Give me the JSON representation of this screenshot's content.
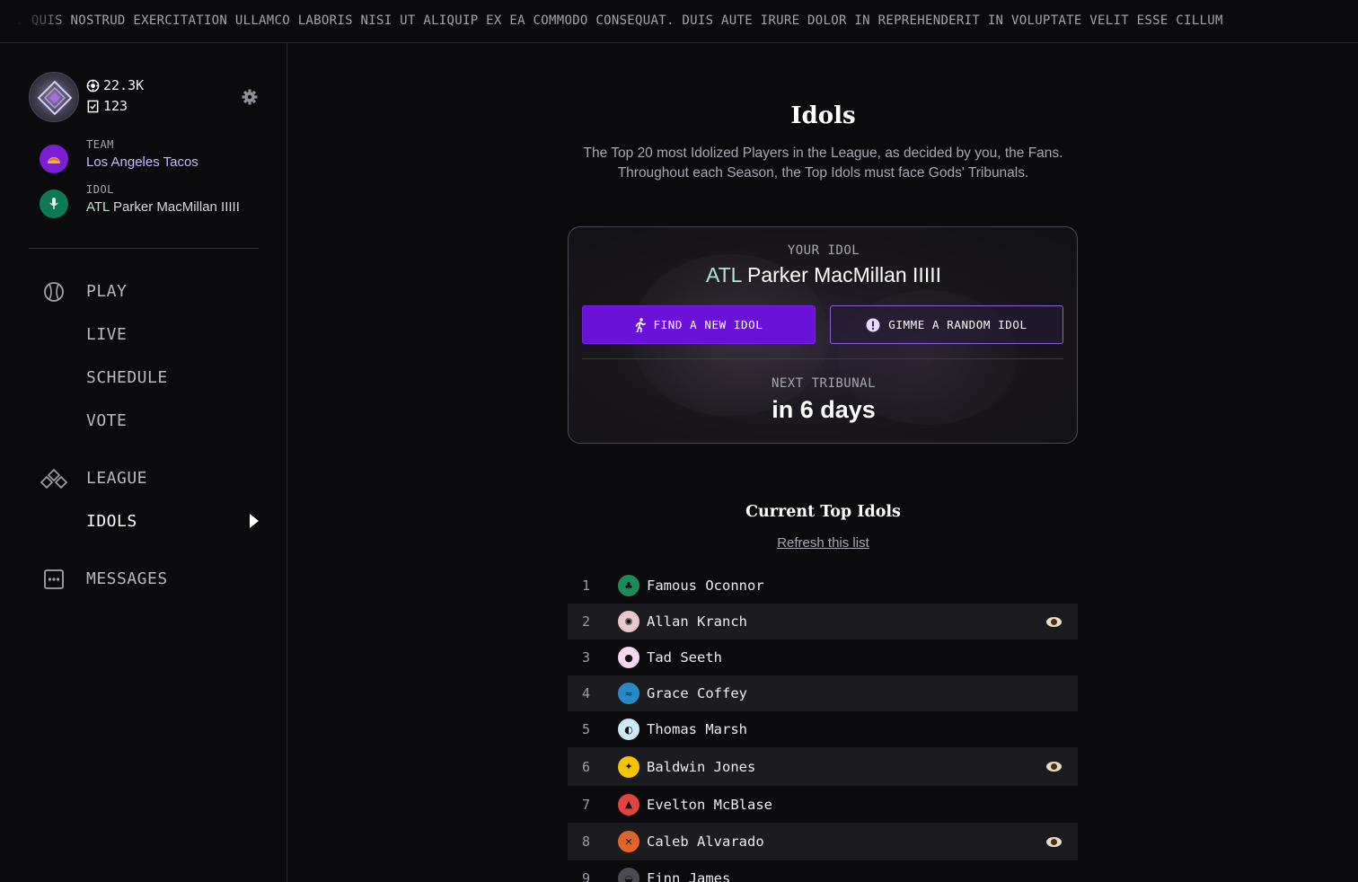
{
  "ticker": {
    "text": "AM. QUIS NOSTRUD EXERCITATION ULLAMCO LABORIS NISI UT ALIQUIP EX EA COMMODO CONSEQUAT. DUIS AUTE IRURE DOLOR IN REPREHENDERIT IN VOLUPTATE VELIT ESSE CILLUM"
  },
  "profile": {
    "coins": "22.3K",
    "votes": "123",
    "coins_icon": "coin-icon",
    "votes_icon": "vote-icon",
    "settings_icon": "gear-icon"
  },
  "favorites": {
    "team": {
      "label": "TEAM",
      "value": "Los Angeles Tacos",
      "icon": "taco-icon",
      "color": "#7b1fd6"
    },
    "idol": {
      "label": "IDOL",
      "abbr": "ATL",
      "value": "Parker MacMillan IIIII",
      "icon": "microphone-icon",
      "color": "#0c7a55"
    }
  },
  "nav": [
    {
      "label": "PLAY",
      "icon": "baseball-icon",
      "active": false
    },
    {
      "label": "LIVE",
      "active": false
    },
    {
      "label": "SCHEDULE",
      "active": false
    },
    {
      "label": "VOTE",
      "active": false
    },
    {
      "label": "LEAGUE",
      "icon": "diamonds-icon",
      "active": false
    },
    {
      "label": "IDOLS",
      "active": true
    },
    {
      "label": "MESSAGES",
      "icon": "chat-icon",
      "active": false
    }
  ],
  "main": {
    "title": "Idols",
    "subtitle_line1": "The Top 20 most Idolized Players in the League, as decided by you, the Fans.",
    "subtitle_line2": "Throughout each Season, the Top Idols must face Gods' Tribunals."
  },
  "idol_card": {
    "label": "YOUR IDOL",
    "team_abbr": "ATL",
    "player": "Parker MacMillan IIIII",
    "find_button": "FIND A NEW IDOL",
    "random_button": "GIMME A RANDOM IDOL",
    "next_label": "NEXT TRIBUNAL",
    "next_value": "in 6 days"
  },
  "top_idols": {
    "title": "Current Top Idols",
    "refresh_label": "Refresh this list",
    "rows": [
      {
        "rank": "1",
        "name": "Famous Oconnor",
        "icon": "frog-icon",
        "color": "#1a8a5a",
        "glyph": "♣",
        "watched": false
      },
      {
        "rank": "2",
        "name": "Allan Kranch",
        "icon": "crab-icon",
        "color": "#e8c9d0",
        "glyph": "✺",
        "watched": true
      },
      {
        "rank": "3",
        "name": "Tad Seeth",
        "icon": "balloon-icon",
        "color": "#f5d7ef",
        "glyph": "●",
        "watched": false
      },
      {
        "rank": "4",
        "name": "Grace Coffey",
        "icon": "wave-icon",
        "color": "#2a8ac8",
        "glyph": "≈",
        "watched": false
      },
      {
        "rank": "5",
        "name": "Thomas Marsh",
        "icon": "whale-icon",
        "color": "#cde9f3",
        "glyph": "◐",
        "watched": false
      },
      {
        "rank": "6",
        "name": "Baldwin Jones",
        "icon": "comet-icon",
        "color": "#f5c400",
        "glyph": "✦",
        "watched": true
      },
      {
        "rank": "7",
        "name": "Evelton McBlase",
        "icon": "fire-icon",
        "color": "#e0443a",
        "glyph": "▲",
        "watched": false
      },
      {
        "rank": "8",
        "name": "Caleb Alvarado",
        "icon": "crossed-tools-icon",
        "color": "#e0652a",
        "glyph": "✕",
        "watched": true
      },
      {
        "rank": "9",
        "name": "Finn James",
        "icon": "pizza-icon",
        "color": "#4a4a52",
        "glyph": "◒",
        "watched": false
      }
    ]
  }
}
